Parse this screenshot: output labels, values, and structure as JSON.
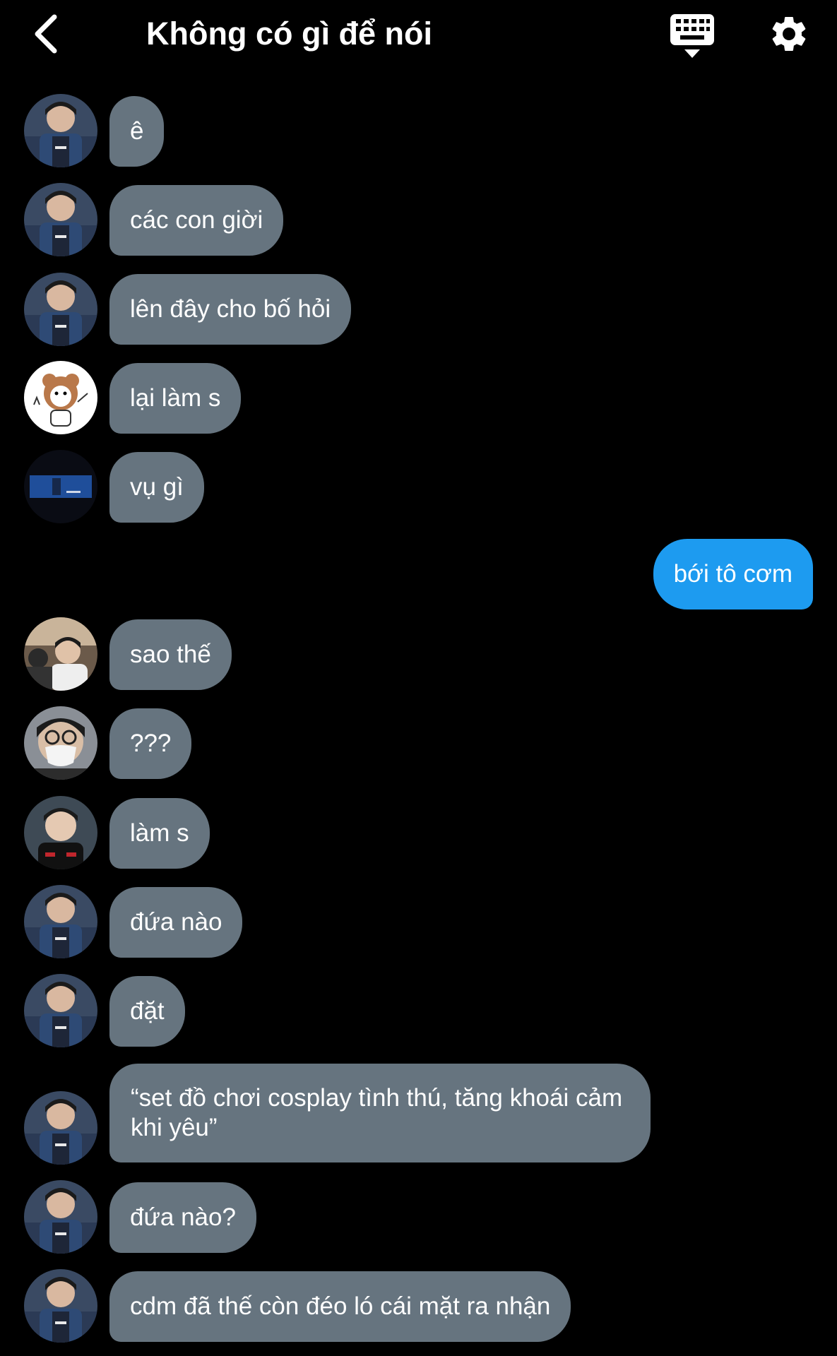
{
  "header": {
    "title": "Không có gì để nói"
  },
  "messages": [
    {
      "text": "ê"
    },
    {
      "text": "các con giời"
    },
    {
      "text": "lên đây cho bố hỏi"
    },
    {
      "text": "lại làm s"
    },
    {
      "text": "vụ gì"
    },
    {
      "text": "bới tô cơm"
    },
    {
      "text": "sao thế"
    },
    {
      "text": "???"
    },
    {
      "text": "làm s"
    },
    {
      "text": "đứa nào"
    },
    {
      "text": "đặt"
    },
    {
      "text": "“set đồ chơi cosplay tình thú, tăng khoái cảm khi yêu”"
    },
    {
      "text": "đứa nào?"
    },
    {
      "text": "cdm đã thế còn đéo ló cái mặt ra nhận"
    }
  ],
  "colors": {
    "background": "#000000",
    "received_bubble": "#66747f",
    "sent_bubble": "#1d9bf0"
  },
  "icons": [
    "chevron-left-icon",
    "keyboard-hide-icon",
    "gear-icon"
  ]
}
